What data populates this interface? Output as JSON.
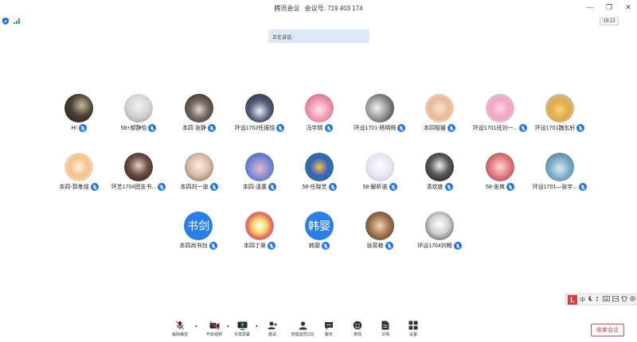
{
  "titlebar": {
    "app_name": "腾讯会议",
    "meeting_id_label": "会议号:",
    "meeting_id": "719 403 174"
  },
  "window_controls": {
    "minimize": "—",
    "restore": "❐",
    "close": "✕"
  },
  "status": {
    "clock": "19:13"
  },
  "speaking_label": "正在讲话:",
  "participants": [
    {
      "name": "H!",
      "avatar": "photo-dark"
    },
    {
      "name": "58+郝静怡",
      "avatar": "photo-sketch"
    },
    {
      "name": "本四 张静",
      "avatar": "photo-anime-dark"
    },
    {
      "name": "环设1702任振恺",
      "avatar": "photo-anime-boy"
    },
    {
      "name": "冯宇晴",
      "avatar": "photo-anime-pink"
    },
    {
      "name": "环设1701-杨明辉",
      "avatar": "photo-anime-bw"
    },
    {
      "name": "本四智媛",
      "avatar": "photo-baby"
    },
    {
      "name": "环设1701班刘一...",
      "avatar": "photo-cartoon-pink"
    },
    {
      "name": "环设1701魏玄轩",
      "avatar": "photo-cartoon-bear"
    },
    {
      "name": "本四-郭孝煊",
      "avatar": "photo-anime-orange"
    },
    {
      "name": "环艺1704团支书...",
      "avatar": "photo-girl"
    },
    {
      "name": "本四刘一迪",
      "avatar": "photo-girl-light"
    },
    {
      "name": "本四-凌童",
      "avatar": "photo-cartoon-blue"
    },
    {
      "name": "58-任晓艺",
      "avatar": "photo-cartoon-mask"
    },
    {
      "name": "58-解昕诺",
      "avatar": "photo-scene"
    },
    {
      "name": "清欢度",
      "avatar": "photo-bw-girl"
    },
    {
      "name": "58-张爽",
      "avatar": "photo-anime-pink2"
    },
    {
      "name": "环设1701—张宇...",
      "avatar": "photo-cartoon-cat"
    },
    {
      "name": "本四尚书剑",
      "avatar": "text",
      "avatar_text": "书剑"
    },
    {
      "name": "本四丁昊",
      "avatar": "photo-colorful"
    },
    {
      "name": "韩婴",
      "avatar": "text",
      "avatar_text": "韩婴"
    },
    {
      "name": "张英艳",
      "avatar": "photo-food"
    },
    {
      "name": "环设1704刘畅",
      "avatar": "photo-anime-sketch"
    }
  ],
  "ime_bar": {
    "logo": "L",
    "mode": "中"
  },
  "toolbar": {
    "unmute": "解除静音",
    "start_video": "开启视频",
    "share_screen": "共享屏幕",
    "invite": "邀请",
    "manage_members": "管理成员(23)",
    "chat": "聊天",
    "reactions": "表情",
    "documents": "文档",
    "settings": "设置",
    "end_meeting": "结束会议"
  },
  "colors": {
    "accent": "#1f72de",
    "end": "#e03a3a",
    "speaking_bg": "#dde9f7"
  }
}
